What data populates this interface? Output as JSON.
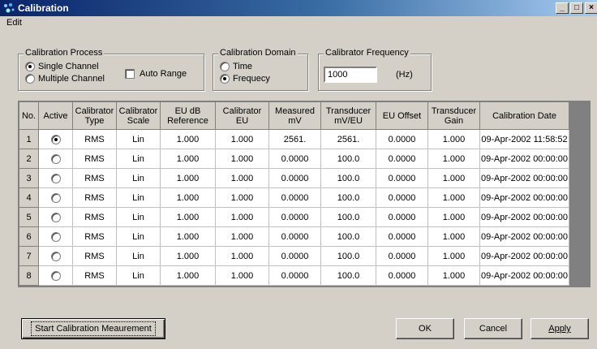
{
  "window": {
    "title": "Calibration",
    "controls": [
      "_",
      "□",
      "×"
    ]
  },
  "menu": {
    "items": [
      "Edit"
    ]
  },
  "calibration_process": {
    "label": "Calibration Process",
    "options": [
      "Single Channel",
      "Multiple Channel"
    ],
    "selected": "Single Channel",
    "auto_range_label": "Auto Range",
    "auto_range_checked": false
  },
  "calibration_domain": {
    "label": "Calibration Domain",
    "options": [
      "Time",
      "Frequecy"
    ],
    "selected": "Frequecy"
  },
  "calibrator_frequency": {
    "label": "Calibrator Frequency",
    "value": "1000",
    "unit": "(Hz)"
  },
  "table": {
    "headers": [
      "No.",
      "Active",
      "Calibrator Type",
      "Calibrator Scale",
      "EU dB Reference",
      "Calibrator EU",
      "Measured mV",
      "Transducer mV/EU",
      "EU Offset",
      "Transducer Gain",
      "Calibration Date"
    ],
    "rows": [
      [
        "1",
        true,
        "RMS",
        "Lin",
        "1.000",
        "1.000",
        "2561.",
        "2561.",
        "0.0000",
        "1.000",
        "09-Apr-2002 11:58:52"
      ],
      [
        "2",
        false,
        "RMS",
        "Lin",
        "1.000",
        "1.000",
        "0.0000",
        "100.0",
        "0.0000",
        "1.000",
        "09-Apr-2002 00:00:00"
      ],
      [
        "3",
        false,
        "RMS",
        "Lin",
        "1.000",
        "1.000",
        "0.0000",
        "100.0",
        "0.0000",
        "1.000",
        "09-Apr-2002 00:00:00"
      ],
      [
        "4",
        false,
        "RMS",
        "Lin",
        "1.000",
        "1.000",
        "0.0000",
        "100.0",
        "0.0000",
        "1.000",
        "09-Apr-2002 00:00:00"
      ],
      [
        "5",
        false,
        "RMS",
        "Lin",
        "1.000",
        "1.000",
        "0.0000",
        "100.0",
        "0.0000",
        "1.000",
        "09-Apr-2002 00:00:00"
      ],
      [
        "6",
        false,
        "RMS",
        "Lin",
        "1.000",
        "1.000",
        "0.0000",
        "100.0",
        "0.0000",
        "1.000",
        "09-Apr-2002 00:00:00"
      ],
      [
        "7",
        false,
        "RMS",
        "Lin",
        "1.000",
        "1.000",
        "0.0000",
        "100.0",
        "0.0000",
        "1.000",
        "09-Apr-2002 00:00:00"
      ],
      [
        "8",
        false,
        "RMS",
        "Lin",
        "1.000",
        "1.000",
        "0.0000",
        "100.0",
        "0.0000",
        "1.000",
        "09-Apr-2002 00:00:00"
      ]
    ]
  },
  "buttons": {
    "start": "Start Calibration Meaurement",
    "ok": "OK",
    "cancel": "Cancel",
    "apply": "Apply"
  },
  "colors": {
    "titlebar_start": "#0a246a",
    "titlebar_end": "#a6caf0",
    "face": "#d4d0c8"
  }
}
